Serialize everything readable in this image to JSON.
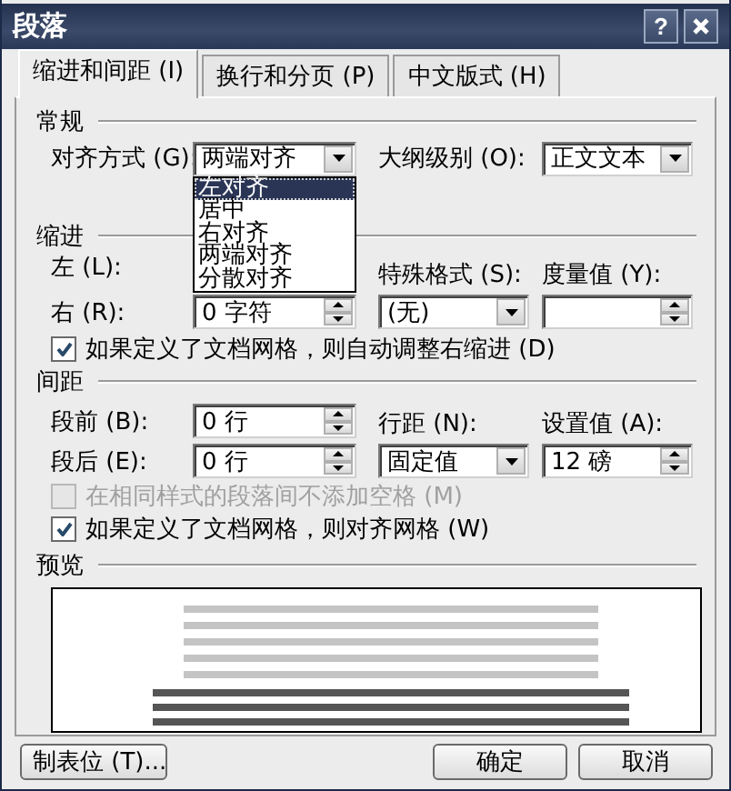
{
  "window": {
    "title": "段落",
    "help_button": "?"
  },
  "tabs": [
    {
      "label": "缩进和间距 (I)",
      "selected": true
    },
    {
      "label": "换行和分页 (P)",
      "selected": false
    },
    {
      "label": "中文版式 (H)",
      "selected": false
    }
  ],
  "general": {
    "heading": "常规",
    "alignment": {
      "label": "对齐方式 (G):",
      "value": "两端对齐",
      "expanded": true,
      "options": [
        {
          "label": "左对齐",
          "highlighted": true
        },
        {
          "label": "居中",
          "highlighted": false
        },
        {
          "label": "右对齐",
          "highlighted": false
        },
        {
          "label": "两端对齐",
          "highlighted": false
        },
        {
          "label": "分散对齐",
          "highlighted": false
        }
      ]
    },
    "outline_level": {
      "label": "大纲级别 (O):",
      "value": "正文文本"
    }
  },
  "indent": {
    "heading": "缩进",
    "left": {
      "label": "左 (L):"
    },
    "right": {
      "label": "右 (R):",
      "value": "0 字符"
    },
    "special": {
      "label": "特殊格式 (S):",
      "value": "(无)"
    },
    "by": {
      "label": "度量值 (Y):"
    },
    "auto_adjust": {
      "label": "如果定义了文档网格，则自动调整右缩进 (D)",
      "checked": true,
      "disabled": false
    }
  },
  "spacing": {
    "heading": "间距",
    "before": {
      "label": "段前 (B):",
      "value": "0 行"
    },
    "after": {
      "label": "段后 (E):",
      "value": "0 行"
    },
    "line_spacing": {
      "label": "行距 (N):",
      "value": "固定值"
    },
    "at": {
      "label": "设置值 (A):",
      "value": "12 磅"
    },
    "checks": [
      {
        "label": "在相同样式的段落间不添加空格 (M)",
        "checked": false,
        "disabled": true
      },
      {
        "label": "如果定义了文档网格，则对齐网格 (W)",
        "checked": true,
        "disabled": false
      }
    ]
  },
  "preview": {
    "heading": "预览"
  },
  "buttons": [
    {
      "label": "制表位 (T)..."
    },
    {
      "label": "确定"
    },
    {
      "label": "取消"
    }
  ]
}
